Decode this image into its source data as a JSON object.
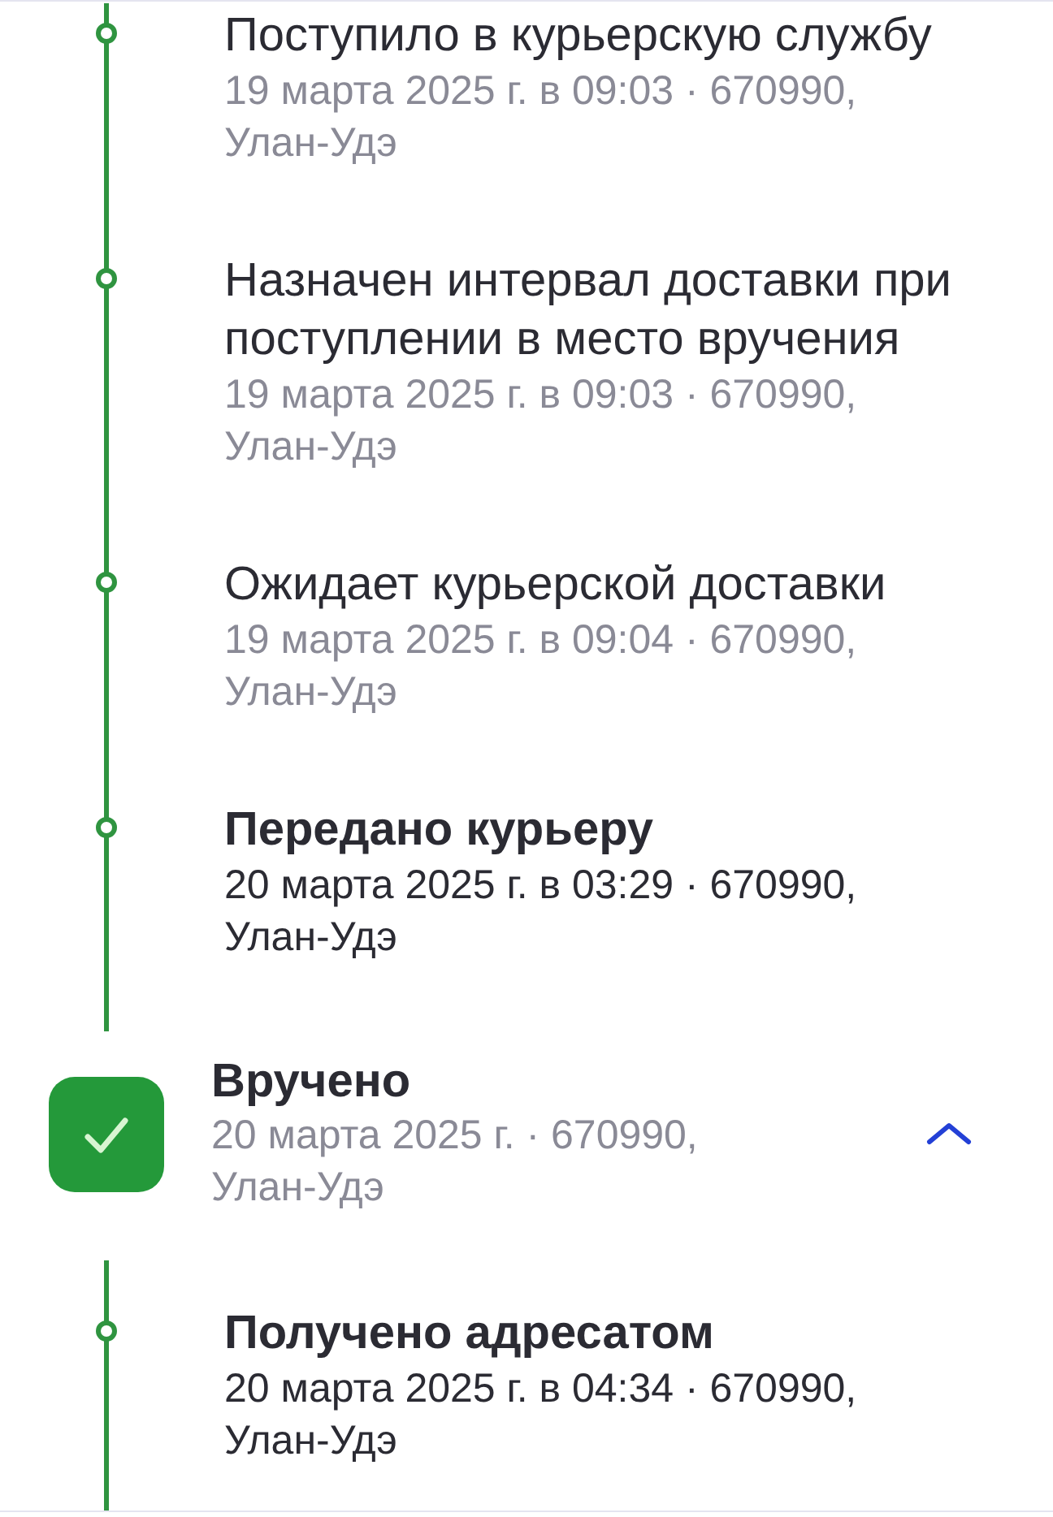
{
  "timeline": {
    "events": [
      {
        "title": "Поступило в курьерскую службу",
        "details": "19 марта 2025 г. в 09:03 · 670990, Улан-Удэ",
        "highlighted": false
      },
      {
        "title": "Назначен интервал доставки при поступлении в место вручения",
        "details": "19 марта 2025 г. в 09:03 · 670990, Улан-Удэ",
        "highlighted": false
      },
      {
        "title": "Ожидает курьерской доставки",
        "details": "19 марта 2025 г. в 09:04 · 670990, Улан-Удэ",
        "highlighted": false
      },
      {
        "title": "Передано курьеру",
        "details": "20 марта 2025 г. в 03:29 · 670990, Улан-Удэ",
        "highlighted": true
      }
    ]
  },
  "group": {
    "title": "Вручено",
    "details": "20 марта 2025 г. · 670990, Улан-Удэ",
    "expanded": true,
    "events": [
      {
        "title": "Получено адресатом",
        "details": "20 марта 2025 г. в 04:34 · 670990, Улан-Удэ",
        "highlighted": true
      }
    ]
  }
}
